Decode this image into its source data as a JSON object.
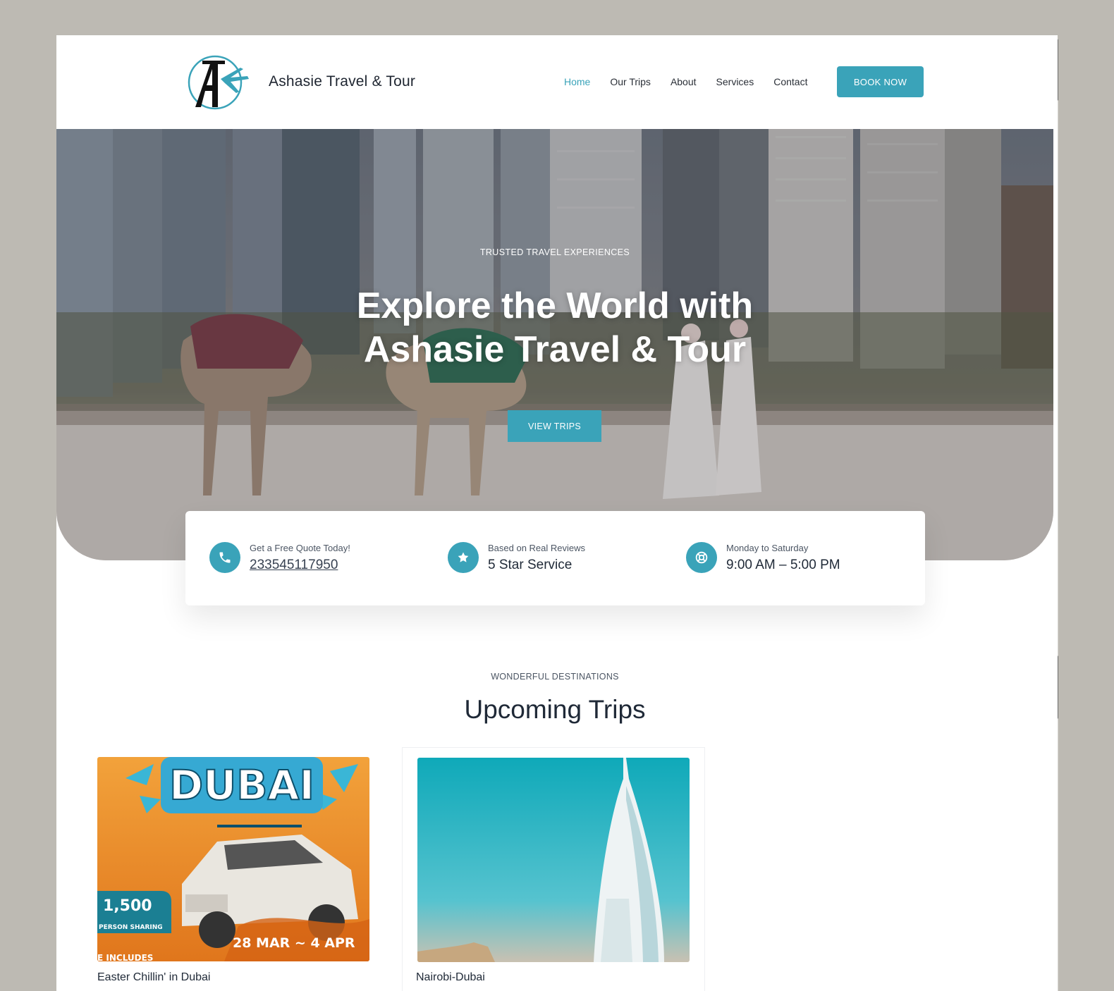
{
  "header": {
    "brand": "Ashasie Travel & Tour",
    "nav": [
      "Home",
      "Our Trips",
      "About",
      "Services",
      "Contact"
    ],
    "active_nav": "Home",
    "cta": "BOOK NOW"
  },
  "hero": {
    "eyebrow": "TRUSTED TRAVEL EXPERIENCES",
    "title_line1": "Explore the World with",
    "title_line2": "Ashasie Travel & Tour",
    "button": "VIEW TRIPS"
  },
  "info": {
    "quote_label": "Get a Free Quote Today!",
    "quote_value": "233545117950",
    "reviews_label": "Based on Real Reviews",
    "reviews_value": "5 Star Service",
    "hours_label": "Monday to Saturday",
    "hours_value": "9:00 AM – 5:00 PM"
  },
  "upcoming": {
    "eyebrow": "WONDERFUL DESTINATIONS",
    "title": "Upcoming Trips",
    "trips": [
      {
        "name": "Easter Chillin' in Dubai",
        "image_text": {
          "headline": "DUBAI",
          "price": "1,500",
          "price_note": "PERSON SHARING",
          "dates": "28 MAR ~ 4 APR",
          "footer": "E INCLUDES"
        }
      },
      {
        "name": "Nairobi-Dubai"
      }
    ]
  },
  "colors": {
    "accent": "#3aa3b9",
    "text_dark": "#1f2937",
    "page_bg": "#bdbab3"
  }
}
